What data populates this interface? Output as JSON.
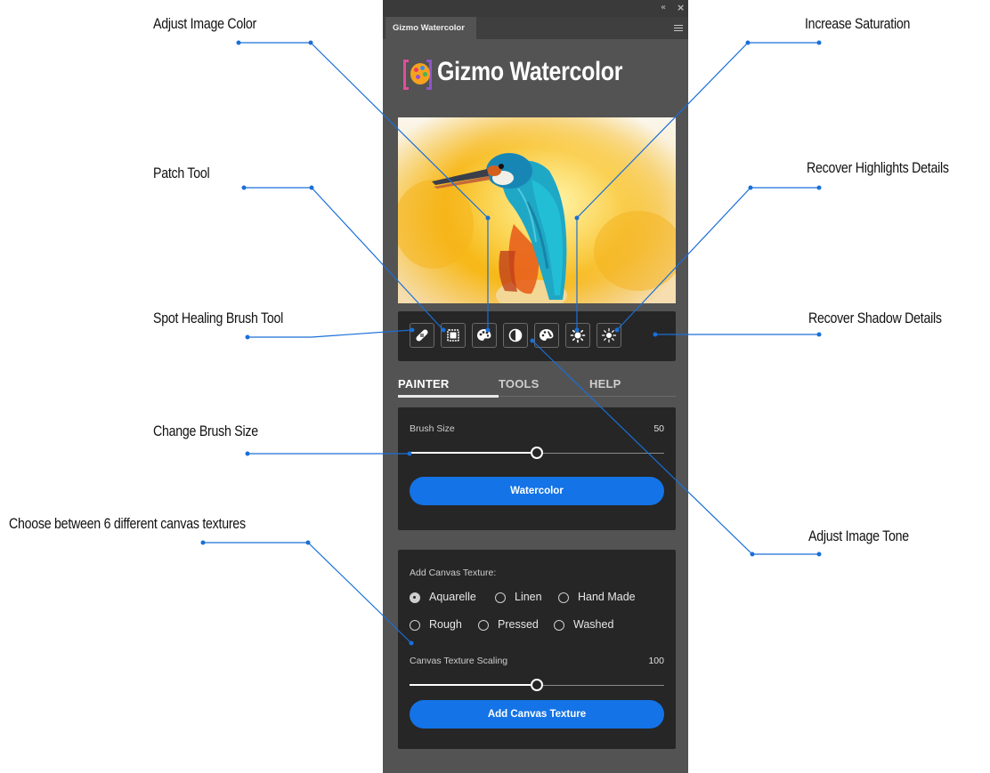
{
  "panel": {
    "tab_title": "Gizmo Watercolor",
    "logo_text": "Gizmo Watercolor",
    "collapse_glyph": "«",
    "close_glyph": "×"
  },
  "tools": [
    {
      "icon": "spot-healing-brush-icon"
    },
    {
      "icon": "patch-tool-icon"
    },
    {
      "icon": "palette-color-icon"
    },
    {
      "icon": "contrast-tone-icon"
    },
    {
      "icon": "saturation-palette-icon"
    },
    {
      "icon": "highlights-sun-icon"
    },
    {
      "icon": "shadows-sun-icon"
    }
  ],
  "tabs": [
    {
      "label": "PAINTER",
      "active": true
    },
    {
      "label": "TOOLS",
      "active": false
    },
    {
      "label": "HELP",
      "active": false
    }
  ],
  "painter": {
    "brush_size_label": "Brush Size",
    "brush_size_value": "50",
    "brush_size_fraction": 0.5,
    "button_label": "Watercolor"
  },
  "texture": {
    "title": "Add Canvas Texture:",
    "options": [
      {
        "label": "Aquarelle",
        "selected": true
      },
      {
        "label": "Linen",
        "selected": false
      },
      {
        "label": "Hand Made",
        "selected": false
      },
      {
        "label": "Rough",
        "selected": false
      },
      {
        "label": "Pressed",
        "selected": false
      },
      {
        "label": "Washed",
        "selected": false
      }
    ],
    "scaling_label": "Canvas Texture Scaling",
    "scaling_value": "100",
    "scaling_fraction": 0.5,
    "button_label": "Add Canvas Texture"
  },
  "callouts": {
    "adjust_image_color": "Adjust Image Color",
    "patch_tool": "Patch Tool",
    "spot_healing_brush_tool": "Spot Healing Brush Tool",
    "change_brush_size": "Change Brush Size",
    "canvas_textures": "Choose between 6 different canvas textures",
    "increase_saturation": "Increase Saturation",
    "recover_highlights": "Recover Highlights Details",
    "recover_shadow": "Recover Shadow Details",
    "adjust_image_tone": "Adjust Image Tone"
  },
  "colors": {
    "panel_bg": "#535353",
    "card_bg": "#262626",
    "accent_blue": "#1473e6",
    "leader_line": "#1a6fd8"
  }
}
